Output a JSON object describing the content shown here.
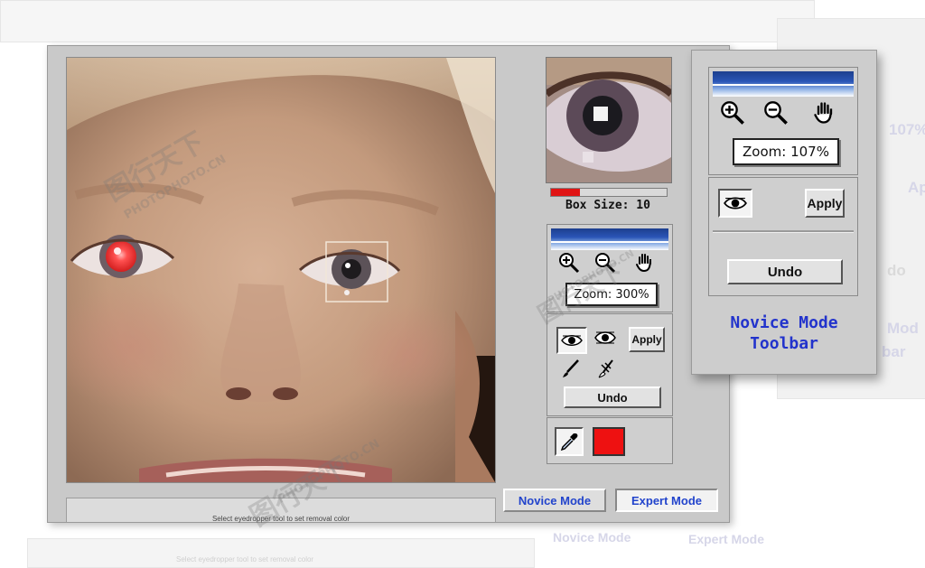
{
  "photo_area": {
    "status_text": "Select eyedropper tool to set removal color"
  },
  "preview": {
    "box_size_label": "Box Size: 10",
    "box_size_fraction": 0.25
  },
  "expert_toolbar": {
    "zoom_label": "Zoom: 300%",
    "apply_label": "Apply",
    "undo_label": "Undo",
    "removal_color": "#ee1111"
  },
  "mode_buttons": {
    "novice": "Novice Mode",
    "expert": "Expert Mode"
  },
  "novice_toolbar": {
    "zoom_label": "Zoom: 107%",
    "apply_label": "Apply",
    "undo_label": "Undo",
    "caption_line1": "Novice Mode",
    "caption_line2": "Toolbar"
  },
  "background_ghost": {
    "zoom_fragment": "107%",
    "apply_fragment": "Ap",
    "undo_fragment": "do",
    "caption_fragment1": "Mod",
    "caption_fragment2": "bar",
    "novice_mode": "Novice Mode",
    "expert_mode": "Expert Mode",
    "status_text": "Select eyedropper tool to set removal color"
  },
  "watermarks": [
    "图行天下",
    "PHOTOPHOTO.CN"
  ],
  "icons": [
    "zoom-in-icon",
    "zoom-out-icon",
    "hand-icon",
    "eye-icon",
    "eye-scan-icon",
    "brush-icon",
    "eraser-icon",
    "eyedropper-icon"
  ]
}
